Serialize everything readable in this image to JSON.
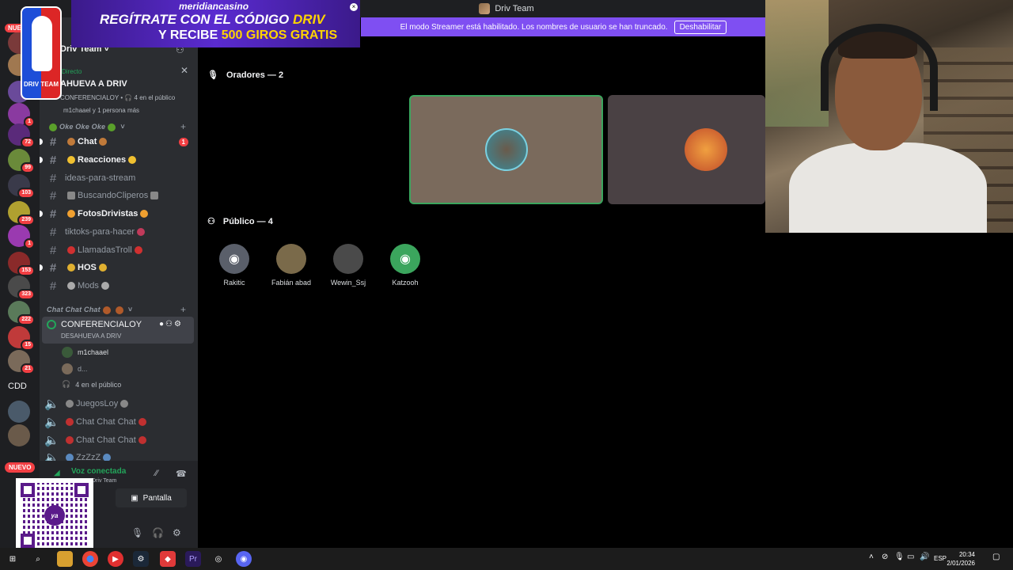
{
  "window": {
    "title": "Driv Team"
  },
  "streamer_banner": {
    "text": "El modo Streamer está habilitado. Los nombres de usuario se han truncado.",
    "button": "Deshabilitar"
  },
  "sponsor": {
    "brand": "meridiancasino",
    "line1": "REGÍTRATE CON EL CÓDIGO",
    "code": "DRIV",
    "line2_prefix": "Y RECIBE",
    "line2_accent": "500 GIROS GRATIS"
  },
  "logo": {
    "text": "DRIV TEAM"
  },
  "rail": {
    "badges": [
      "1",
      "72",
      "99",
      "103",
      "239",
      "1",
      "153",
      "323",
      "222",
      "15",
      "21"
    ],
    "text_item": "CDD",
    "new_label": "NUEVO",
    "top_label": "NUE"
  },
  "sidebar": {
    "server_name": "Driv Team",
    "stage": {
      "live_label": "Directo",
      "title": "AHUEVA A DRIV",
      "subtitle": "CONFERENCIALOY",
      "listeners": "4 en el público",
      "members": "m1chaael y 1 persona más"
    },
    "categories": [
      {
        "label": "Oke Oke Oke"
      },
      {
        "label": "Chat Chat Chat"
      }
    ],
    "channels": [
      {
        "label": "Chat",
        "unread": true,
        "badge": "1"
      },
      {
        "label": "Reacciones",
        "unread": true,
        "badge": ""
      },
      {
        "label": "ideas-para-stream",
        "unread": false,
        "badge": ""
      },
      {
        "label": "BuscandoCliperos",
        "unread": false,
        "badge": ""
      },
      {
        "label": "FotosDrivistas",
        "unread": true,
        "badge": ""
      },
      {
        "label": "tiktoks-para-hacer",
        "unread": false,
        "badge": ""
      },
      {
        "label": "LlamadasTroll",
        "unread": false,
        "badge": ""
      },
      {
        "label": "HOS",
        "unread": true,
        "badge": ""
      },
      {
        "label": "Mods",
        "unread": false,
        "badge": ""
      }
    ],
    "voice_channel": {
      "name": "CONFERENCIALOY",
      "topic": "DESAHUEVA A DRIV",
      "users": [
        "m1chaael",
        "d..."
      ],
      "listeners": "4 en el público"
    },
    "voice_channels": [
      {
        "label": "JuegosLoy"
      },
      {
        "label": "Chat Chat Chat"
      },
      {
        "label": "Chat Chat Chat"
      },
      {
        "label": "ZzZzZ"
      }
    ],
    "panel": {
      "status": "Voz conectada",
      "server": "Driv Team",
      "screen_button": "Pantalla"
    }
  },
  "main": {
    "speakers_heading": "Oradores — 2",
    "audience_heading": "Público — 4",
    "audience": [
      "Rakitic",
      "Fabián abad",
      "Wewin_Ssj",
      "Katzooh"
    ]
  },
  "taskbar": {
    "language": "ESP",
    "time": "20:34",
    "date": "2/01/2026"
  }
}
